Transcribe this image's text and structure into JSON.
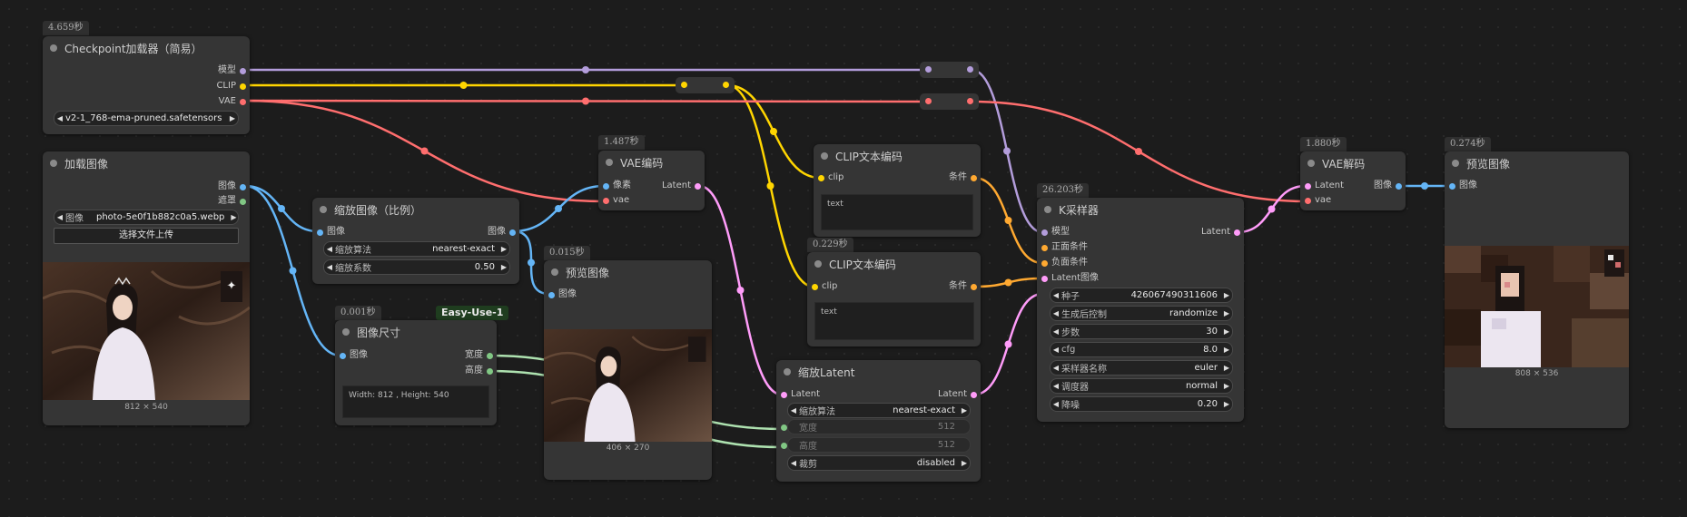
{
  "colors": {
    "model": "#b39ddb",
    "clip": "#ffd500",
    "vae": "#ff6e6e",
    "image": "#64b5f6",
    "mask": "#81c784",
    "latent": "#ff9cf9",
    "cond": "#ffa931",
    "int": "#aee2b0"
  },
  "checkpoint": {
    "time": "4.659秒",
    "title": "Checkpoint加载器（简易）",
    "out_model": "模型",
    "out_clip": "CLIP",
    "out_vae": "VAE",
    "ckpt": "v2-1_768-ema-pruned.safetensors"
  },
  "load_image": {
    "title": "加载图像",
    "out_image": "图像",
    "out_mask": "遮罩",
    "image_label": "图像",
    "image_value": "photo-5e0f1b882c0a5.webp",
    "upload": "选择文件上传",
    "caption": "812 × 540"
  },
  "scale_image": {
    "title": "缩放图像（比例）",
    "in_image": "图像",
    "out_image": "图像",
    "method_label": "缩放算法",
    "method_value": "nearest-exact",
    "factor_label": "缩放系数",
    "factor_value": "0.50"
  },
  "image_size": {
    "time": "0.001秒",
    "tag": "Easy-Use-1",
    "title": "图像尺寸",
    "in_image": "图像",
    "out_width": "宽度",
    "out_height": "高度",
    "text": "Width: 812 , Height: 540"
  },
  "vae_encode": {
    "time": "1.487秒",
    "title": "VAE编码",
    "in_pixels": "像素",
    "in_vae": "vae",
    "out_latent": "Latent"
  },
  "preview_mid": {
    "time": "0.015秒",
    "title": "预览图像",
    "in_image": "图像",
    "caption": "406 × 270"
  },
  "clip_pos": {
    "title": "CLIP文本编码",
    "in_clip": "clip",
    "out_cond": "条件",
    "text": "text"
  },
  "clip_neg": {
    "time": "0.229秒",
    "title": "CLIP文本编码",
    "in_clip": "clip",
    "out_cond": "条件",
    "text": "text"
  },
  "scale_latent": {
    "title": "缩放Latent",
    "in_latent": "Latent",
    "out_latent": "Latent",
    "method_label": "缩放算法",
    "method_value": "nearest-exact",
    "width_label": "宽度",
    "width_value": "512",
    "height_label": "高度",
    "height_value": "512",
    "crop_label": "裁剪",
    "crop_value": "disabled"
  },
  "ksampler": {
    "time": "26.203秒",
    "title": "K采样器",
    "in_model": "模型",
    "in_pos": "正面条件",
    "in_neg": "负面条件",
    "in_latent": "Latent图像",
    "out_latent": "Latent",
    "widgets": [
      {
        "label": "种子",
        "value": "426067490311606"
      },
      {
        "label": "生成后控制",
        "value": "randomize"
      },
      {
        "label": "步数",
        "value": "30"
      },
      {
        "label": "cfg",
        "value": "8.0"
      },
      {
        "label": "采样器名称",
        "value": "euler"
      },
      {
        "label": "调度器",
        "value": "normal"
      },
      {
        "label": "降噪",
        "value": "0.20"
      }
    ]
  },
  "vae_decode": {
    "time": "1.880秒",
    "title": "VAE解码",
    "in_latent": "Latent",
    "in_vae": "vae",
    "out_image": "图像"
  },
  "preview_final": {
    "time": "0.274秒",
    "title": "预览图像",
    "in_image": "图像",
    "caption": "808 × 536"
  }
}
